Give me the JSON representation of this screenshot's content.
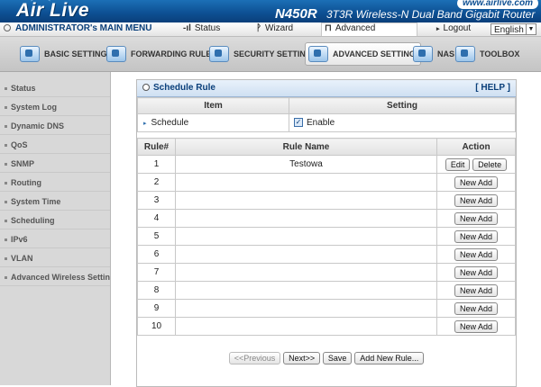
{
  "brand": {
    "logo_text": "Air Live",
    "model": "N450R",
    "tagline": "3T3R Wireless-N Dual Band Gigabit Router",
    "url": "www.airlive.com"
  },
  "mainbar": {
    "admin_menu": "ADMINISTRATOR's MAIN MENU",
    "status": "Status",
    "wizard": "Wizard",
    "advanced": "Advanced",
    "logout": "Logout",
    "language": "English"
  },
  "tabs": [
    {
      "label": "BASIC SETTING"
    },
    {
      "label": "FORWARDING RULES"
    },
    {
      "label": "SECURITY SETTING"
    },
    {
      "label": "ADVANCED SETTING"
    },
    {
      "label": "NAS"
    },
    {
      "label": "TOOLBOX"
    }
  ],
  "sidebar": {
    "items": [
      {
        "label": "Status"
      },
      {
        "label": "System Log"
      },
      {
        "label": "Dynamic DNS"
      },
      {
        "label": "QoS"
      },
      {
        "label": "SNMP"
      },
      {
        "label": "Routing"
      },
      {
        "label": "System Time"
      },
      {
        "label": "Scheduling"
      },
      {
        "label": "IPv6"
      },
      {
        "label": "VLAN"
      },
      {
        "label": "Advanced Wireless Settings"
      }
    ]
  },
  "panel": {
    "title": "Schedule Rule",
    "help": "[ HELP ]",
    "settings_header": {
      "item": "Item",
      "setting": "Setting"
    },
    "schedule_label": "Schedule",
    "enable_label": "Enable",
    "rules_header": {
      "rule_no": "Rule#",
      "rule_name": "Rule Name",
      "action": "Action"
    },
    "rules": [
      {
        "no": "1",
        "name": "Testowa",
        "edit": "Edit",
        "delete": "Delete"
      },
      {
        "no": "2",
        "name": "",
        "add": "New Add"
      },
      {
        "no": "3",
        "name": "",
        "add": "New Add"
      },
      {
        "no": "4",
        "name": "",
        "add": "New Add"
      },
      {
        "no": "5",
        "name": "",
        "add": "New Add"
      },
      {
        "no": "6",
        "name": "",
        "add": "New Add"
      },
      {
        "no": "7",
        "name": "",
        "add": "New Add"
      },
      {
        "no": "8",
        "name": "",
        "add": "New Add"
      },
      {
        "no": "9",
        "name": "",
        "add": "New Add"
      },
      {
        "no": "10",
        "name": "",
        "add": "New Add"
      }
    ],
    "footer": {
      "previous": "<<Previous",
      "next": "Next>>",
      "save": "Save",
      "add_new": "Add New Rule..."
    }
  }
}
